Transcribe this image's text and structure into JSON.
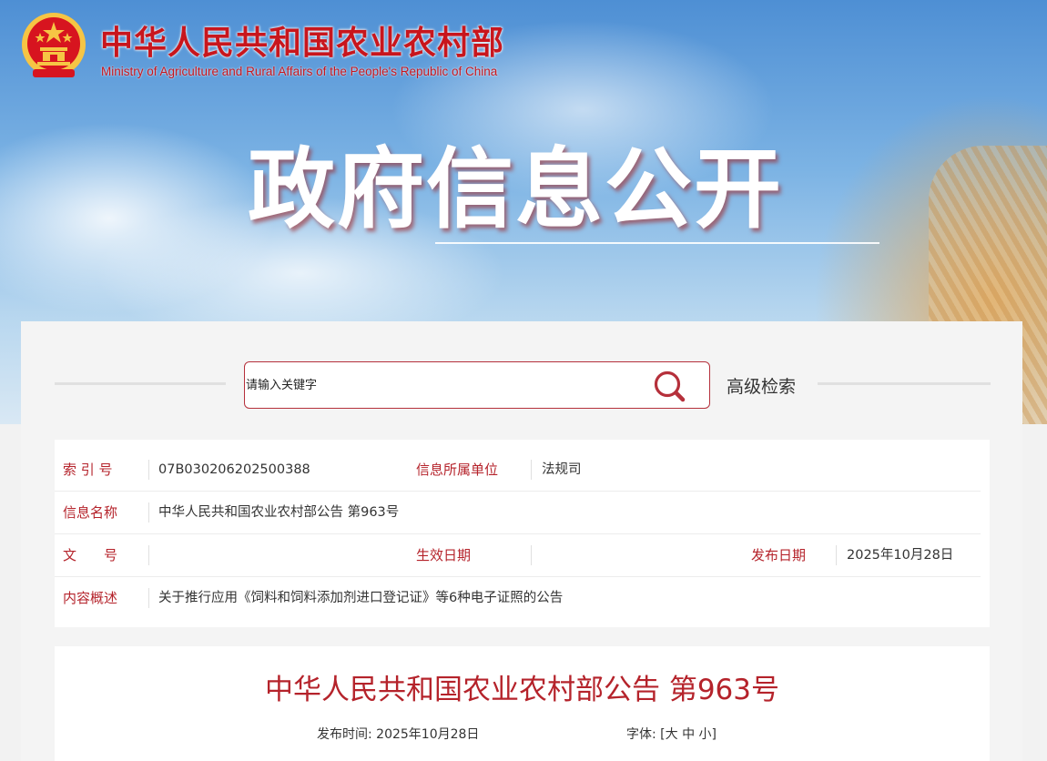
{
  "header": {
    "site_title": "中华人民共和国农业农村部",
    "site_subtitle": "Ministry of Agriculture  and  Rural Affairs  of the People's Republic of China",
    "banner_title": "政府信息公开"
  },
  "search": {
    "placeholder": "请输入关键字",
    "advanced_label": "高级检索"
  },
  "info_table": {
    "index_label": "索 引 号",
    "index_value": "07B030206202500388",
    "unit_label": "信息所属单位",
    "unit_value": "法规司",
    "name_label": "信息名称",
    "name_value": "中华人民共和国农业农村部公告 第963号",
    "doc_no_label": "文　　号",
    "effective_label": "生效日期",
    "publish_label": "发布日期",
    "publish_value": "2025年10月28日",
    "summary_label": "内容概述",
    "summary_value": "关于推行应用《饲料和饲料添加剂进口登记证》等6种电子证照的公告"
  },
  "article": {
    "title": "中华人民共和国农业农村部公告 第963号",
    "publish_time_label": "发布时间:",
    "publish_time_value": "2025年10月28日",
    "font_label": "字体:",
    "font_open": "[",
    "font_large": "大",
    "font_medium": "中",
    "font_small": "小",
    "font_close": "]"
  },
  "colors": {
    "brand_red": "#c8161d",
    "label_red": "#b5232b",
    "search_border": "#b5303b",
    "emblem_gold": "#f6c544"
  },
  "icons": {
    "emblem": "national-emblem-icon",
    "search": "search-icon"
  }
}
